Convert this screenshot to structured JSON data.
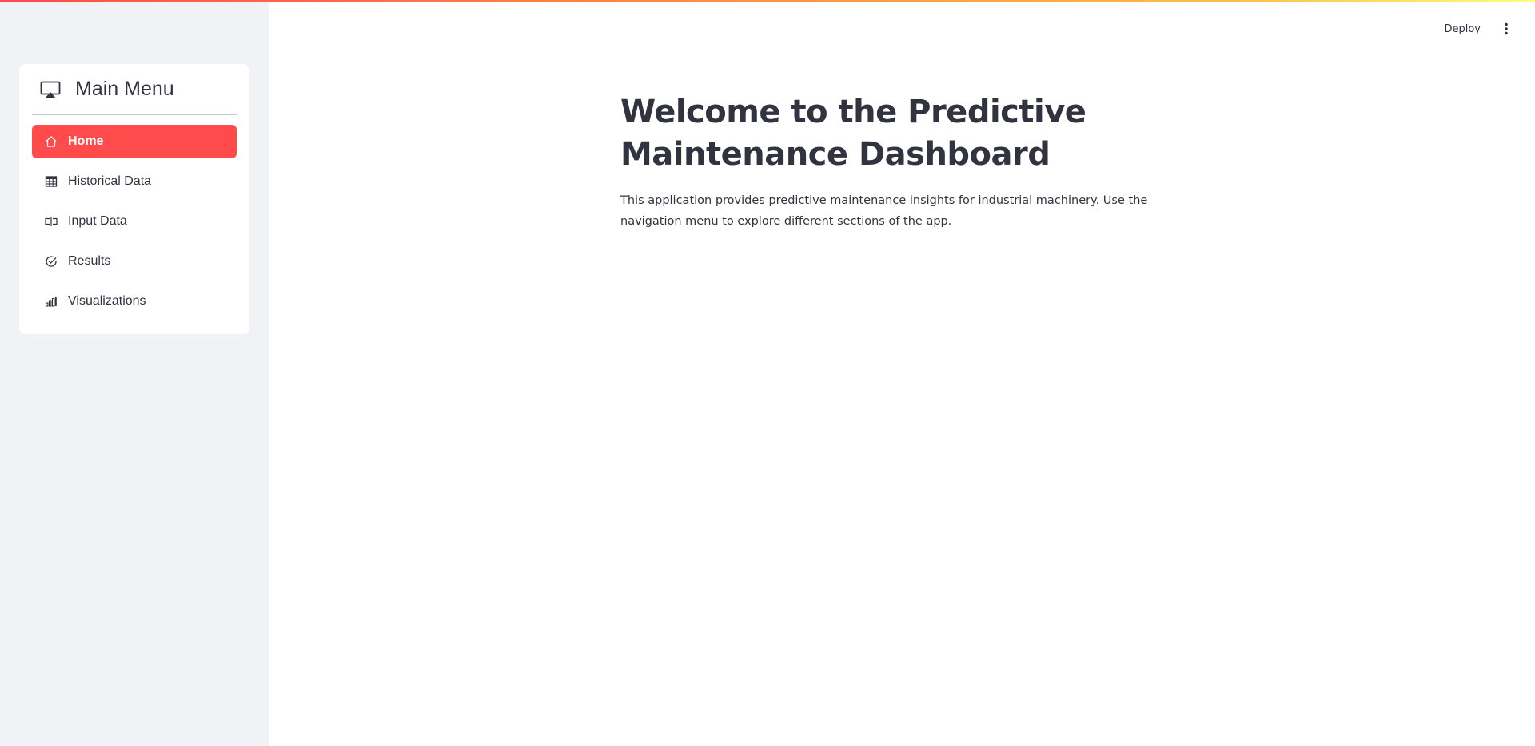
{
  "toolbar": {
    "deploy_label": "Deploy",
    "more_icon": "kebab-vertical-icon"
  },
  "sidebar": {
    "menu_title": "Main Menu",
    "menu_icon": "cast-icon",
    "items": [
      {
        "label": "Home",
        "icon": "house-icon",
        "active": true
      },
      {
        "label": "Historical Data",
        "icon": "table-icon",
        "active": false
      },
      {
        "label": "Input Data",
        "icon": "input-cursor-icon",
        "active": false
      },
      {
        "label": "Results",
        "icon": "check-circle-icon",
        "active": false
      },
      {
        "label": "Visualizations",
        "icon": "bar-chart-icon",
        "active": false
      }
    ],
    "accent_color": "#ff4b4b"
  },
  "main": {
    "title": "Welcome to the Predictive Maintenance Dashboard",
    "description": "This application provides predictive maintenance insights for industrial machinery. Use the navigation menu to explore different sections of the app."
  }
}
